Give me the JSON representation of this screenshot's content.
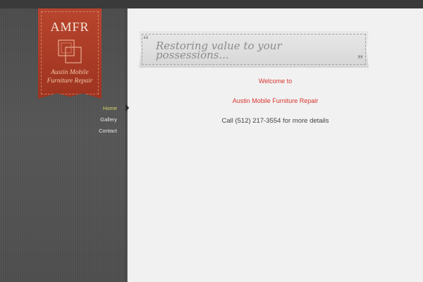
{
  "logo": {
    "title": "AMFR",
    "tagline": "Austin Mobile Furniture Repair",
    "colors": {
      "banner": "#a83a25",
      "text": "#f5e6dc",
      "tagline": "#f0c9a8"
    }
  },
  "nav": {
    "items": [
      {
        "label": "Home",
        "active": true
      },
      {
        "label": "Gallery",
        "active": false
      },
      {
        "label": "Contact",
        "active": false
      }
    ],
    "colors": {
      "normal": "#e8e8e8",
      "active": "#d8d86a"
    }
  },
  "quote": {
    "open_mark": "“",
    "close_mark": "”",
    "text": "Restoring value to your possessions..."
  },
  "content": {
    "welcome": "Welcome to",
    "company": "Austin Mobile Furniture Repair",
    "details": "Call (512) 217-3554 for more details",
    "colors": {
      "accent": "#d9362f",
      "body": "#444444"
    }
  }
}
